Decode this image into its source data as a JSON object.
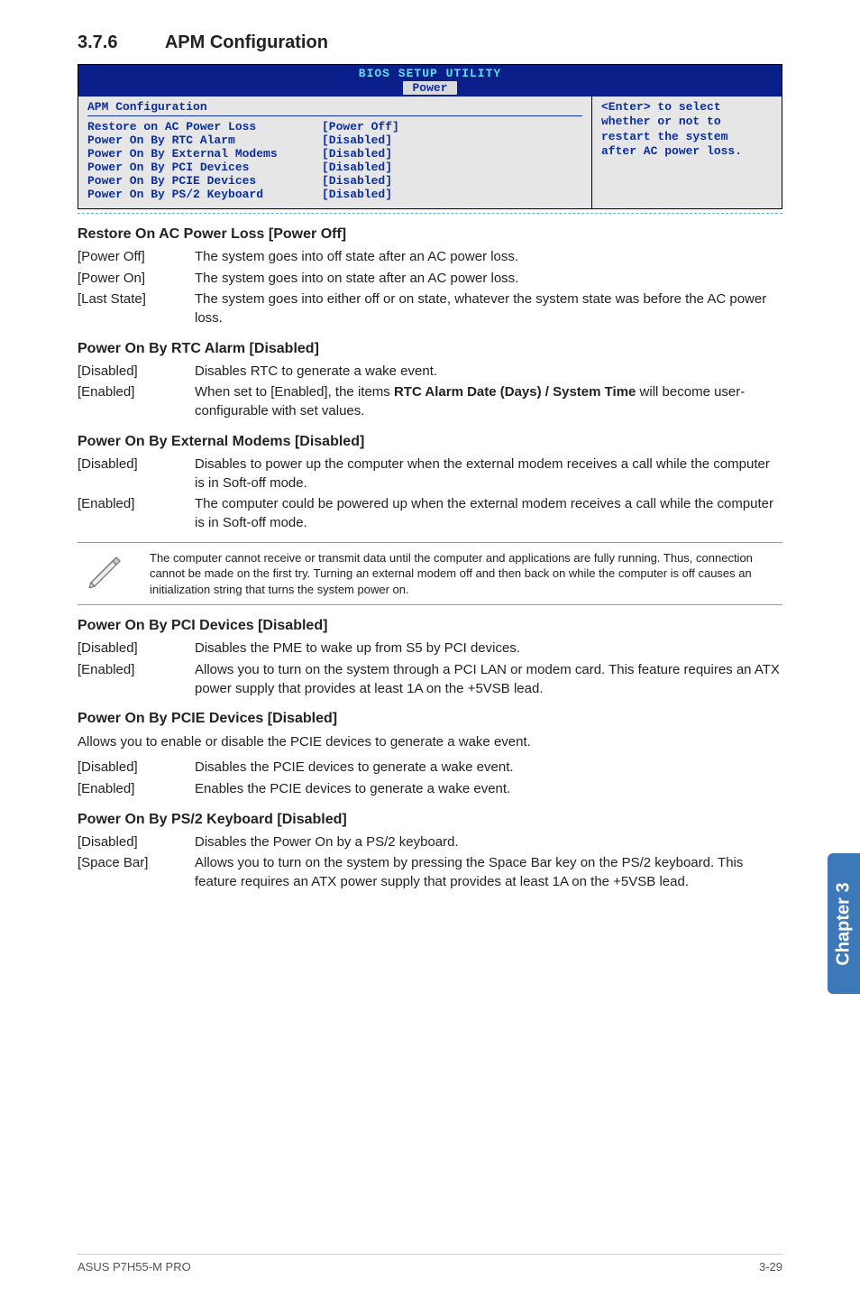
{
  "section": {
    "number": "3.7.6",
    "title": "APM Configuration"
  },
  "bios": {
    "title": "BIOS SETUP UTILITY",
    "tab": "Power",
    "heading": "APM Configuration",
    "rows": [
      {
        "k": "Restore on AC Power Loss",
        "v": "[Power Off]"
      },
      {
        "k": "Power On By RTC Alarm",
        "v": "[Disabled]"
      },
      {
        "k": "Power On By External Modems",
        "v": "[Disabled]"
      },
      {
        "k": "Power On By PCI Devices",
        "v": "[Disabled]"
      },
      {
        "k": "Power On By PCIE Devices",
        "v": "[Disabled]"
      },
      {
        "k": "Power On By PS/2 Keyboard",
        "v": "[Disabled]"
      }
    ],
    "help": {
      "line1": "<Enter> to select",
      "line2": "whether or not to",
      "line3": "restart the system",
      "line4": "after AC power loss."
    }
  },
  "opt1": {
    "heading": "Restore On AC Power Loss [Power Off]",
    "rows": [
      {
        "t": "[Power Off]",
        "d": "The system goes into off state after an AC power loss."
      },
      {
        "t": "[Power On]",
        "d": "The system goes into on state after an AC power loss."
      },
      {
        "t": "[Last State]",
        "d": "The system goes into either off or on state, whatever the system state was before the AC power loss."
      }
    ]
  },
  "opt2": {
    "heading": "Power On By RTC Alarm [Disabled]",
    "rows": [
      {
        "t": "[Disabled]",
        "d": "Disables RTC to generate a wake event."
      }
    ],
    "row_en": {
      "t": "[Enabled]",
      "pre": "When set to [Enabled], the items ",
      "bold": "RTC Alarm Date (Days) / System Time",
      "post": " will become user-configurable with set values."
    }
  },
  "opt3": {
    "heading": "Power On By External Modems [Disabled]",
    "rows": [
      {
        "t": "[Disabled]",
        "d": "Disables to power up the computer when the external modem receives a call while the computer is in Soft-off mode."
      },
      {
        "t": "[Enabled]",
        "d": "The computer could be powered up when the external modem receives a call while the computer is in Soft-off mode."
      }
    ]
  },
  "note": "The computer cannot receive or transmit data until the computer and applications are fully running. Thus, connection cannot be made on the first try. Turning an external modem off and then back on while the computer is off causes an initialization string that turns the system power on.",
  "opt4": {
    "heading": "Power On By PCI Devices [Disabled]",
    "rows": [
      {
        "t": "[Disabled]",
        "d": "Disables the PME to wake up from S5 by PCI devices."
      },
      {
        "t": "[Enabled]",
        "d": "Allows you to turn on the system through a PCI LAN or modem card. This feature requires an ATX power supply that provides at least 1A on the +5VSB lead."
      }
    ]
  },
  "opt5": {
    "heading": "Power On By PCIE Devices [Disabled]",
    "intro": "Allows you to enable or disable the PCIE devices to generate a wake event.",
    "rows": [
      {
        "t": "[Disabled]",
        "d": "Disables the PCIE devices to generate a wake event."
      },
      {
        "t": "[Enabled]",
        "d": "Enables the PCIE devices to generate a wake event."
      }
    ]
  },
  "opt6": {
    "heading": "Power On By PS/2 Keyboard [Disabled]",
    "rows": [
      {
        "t": "[Disabled]",
        "d": "Disables the Power On by a PS/2 keyboard."
      },
      {
        "t": "[Space Bar]",
        "d": "Allows you to turn on the system by pressing the Space Bar key on the PS/2 keyboard. This feature requires an ATX power supply that provides at least 1A on the +5VSB lead."
      }
    ]
  },
  "side_tab": "Chapter 3",
  "footer": {
    "left": "ASUS P7H55-M PRO",
    "right": "3-29"
  }
}
